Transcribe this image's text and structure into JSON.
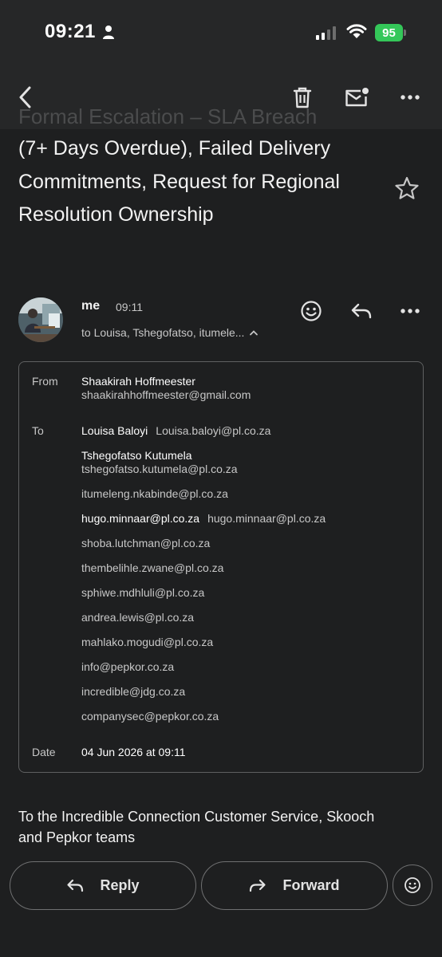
{
  "status_bar": {
    "time": "09:21",
    "battery": "95"
  },
  "toolbar": {
    "title_ghost": "Formal Escalation – SLA Breach"
  },
  "email": {
    "subject": "(7+ Days Overdue), Failed Delivery Commitments, Request for Regional Resolution Ownership",
    "sender": "me",
    "sent_time": "09:11",
    "recipients_summary": "to Louisa, Tshegofatso, itumele..."
  },
  "details": {
    "from_label": "From",
    "from_name": "Shaakirah Hoffmeester",
    "from_email": "shaakirahhoffmeester@gmail.com",
    "to_label": "To",
    "to": [
      {
        "name": "Louisa Baloyi",
        "email": "Louisa.baloyi@pl.co.za"
      },
      {
        "name": "Tshegofatso Kutumela",
        "email": "tshegofatso.kutumela@pl.co.za"
      },
      {
        "name": "",
        "email": "itumeleng.nkabinde@pl.co.za"
      },
      {
        "name": "hugo.minnaar@pl.co.za",
        "email": "hugo.minnaar@pl.co.za"
      },
      {
        "name": "",
        "email": "shoba.lutchman@pl.co.za"
      },
      {
        "name": "",
        "email": "thembelihle.zwane@pl.co.za"
      },
      {
        "name": "",
        "email": "sphiwe.mdhluli@pl.co.za"
      },
      {
        "name": "",
        "email": "andrea.lewis@pl.co.za"
      },
      {
        "name": "",
        "email": "mahlako.mogudi@pl.co.za"
      },
      {
        "name": "",
        "email": "info@pepkor.co.za"
      },
      {
        "name": "",
        "email": "incredible@jdg.co.za"
      },
      {
        "name": "",
        "email": "companysec@pepkor.co.za"
      }
    ],
    "date_label": "Date",
    "date_value": "04 Jun 2026 at 09:11"
  },
  "body": {
    "text": "To the Incredible Connection Customer Service, Skooch and Pepkor teams"
  },
  "actions": {
    "reply_label": "Reply",
    "forward_label": "Forward"
  },
  "icons": [
    "person-icon",
    "signal-icon",
    "wifi-icon",
    "battery-icon",
    "back-arrow-icon",
    "trash-icon",
    "mark-unread-icon",
    "more-vert-icon",
    "star-icon",
    "emoji-icon",
    "reply-icon",
    "more-icon",
    "chevron-up-icon",
    "forward-icon",
    "add-reaction-icon"
  ],
  "colors": {
    "background": "#1e1f20",
    "toolbar": "#262728",
    "battery": "#34c759"
  }
}
